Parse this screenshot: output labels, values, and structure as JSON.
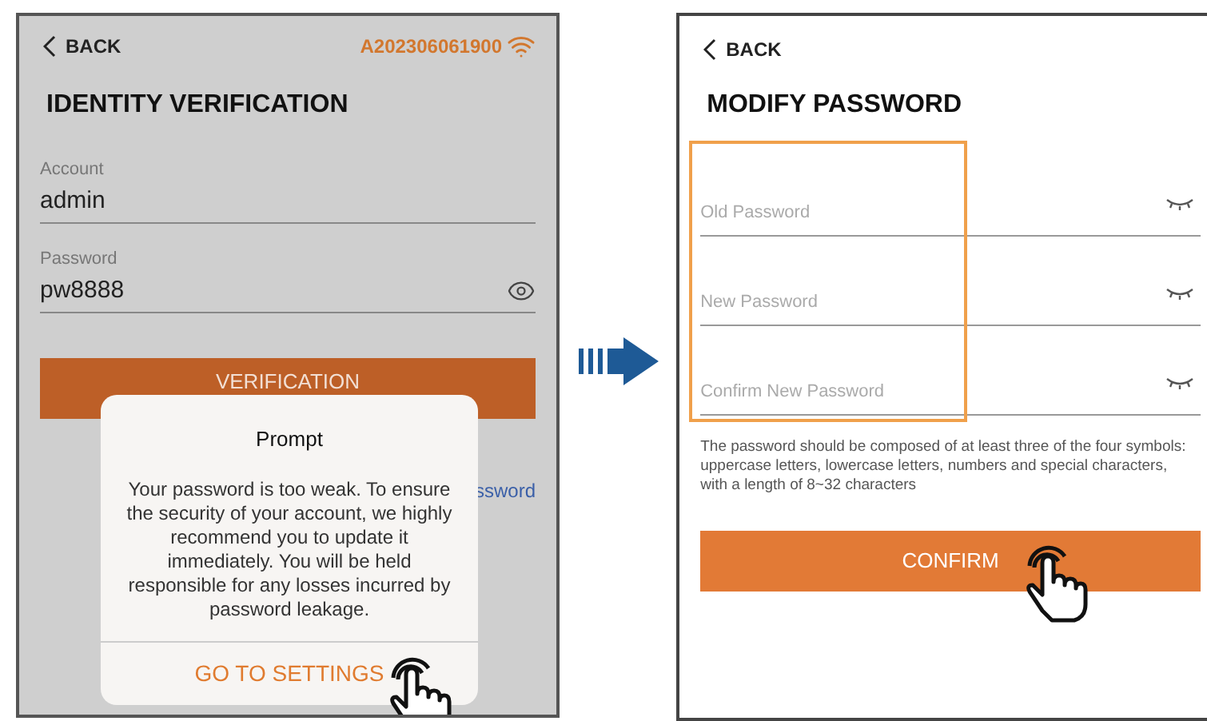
{
  "left_screen": {
    "back": "BACK",
    "serial": "A202306061900",
    "title": "IDENTITY VERIFICATION",
    "fields": [
      {
        "label": "Account",
        "value": "admin",
        "kind": "text"
      },
      {
        "label": "Password",
        "value": "pw8888",
        "kind": "password"
      }
    ],
    "button": "VERIFICATION",
    "link": "ssword",
    "dialog": {
      "title": "Prompt",
      "message": "Your password is too weak. To ensure the security of your account, we highly recommend you to update it immediately. You will be held responsible for any losses incurred by password leakage.",
      "action": "GO TO SETTINGS"
    }
  },
  "right_screen": {
    "back": "BACK",
    "title": "MODIFY PASSWORD",
    "fields": [
      {
        "placeholder": "Old Password",
        "kind": "password"
      },
      {
        "placeholder": "New Password",
        "kind": "password"
      },
      {
        "placeholder": "Confirm New Password",
        "kind": "password"
      }
    ],
    "hint": "The password should be composed of at least three of the four symbols: uppercase letters, lowercase letters, numbers and special characters, with a length of 8~32 characters",
    "button": "CONFIRM"
  }
}
